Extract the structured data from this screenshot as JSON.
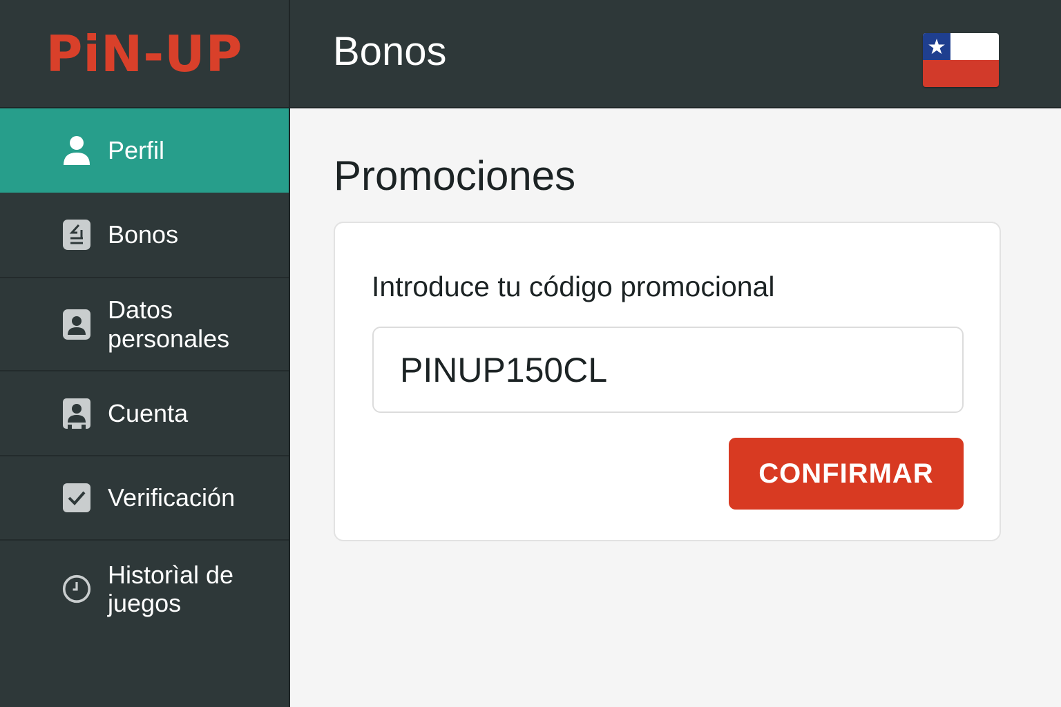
{
  "brand": {
    "logo_text": "PiN-UP",
    "accent_color": "#d83a22",
    "active_color": "#279e8b"
  },
  "header": {
    "title": "Bonos",
    "flag_icon": "chile-flag-icon"
  },
  "sidebar": {
    "items": [
      {
        "label": "Perfil",
        "icon": "user-icon",
        "active": true
      },
      {
        "label": "Bonos",
        "icon": "bonus-icon",
        "active": false
      },
      {
        "label": "Datos personales",
        "icon": "id-card-icon",
        "active": false
      },
      {
        "label": "Cuenta",
        "icon": "account-icon",
        "active": false
      },
      {
        "label": "Verificación",
        "icon": "checkbox-icon",
        "active": false
      },
      {
        "label": "Historìal de juegos",
        "icon": "clock-icon",
        "active": false
      }
    ]
  },
  "main": {
    "title": "Promociones",
    "promo": {
      "label": "Introduce tu código promocional",
      "value": "PINUP150CL",
      "button_label": "CONFIRMAR"
    }
  }
}
